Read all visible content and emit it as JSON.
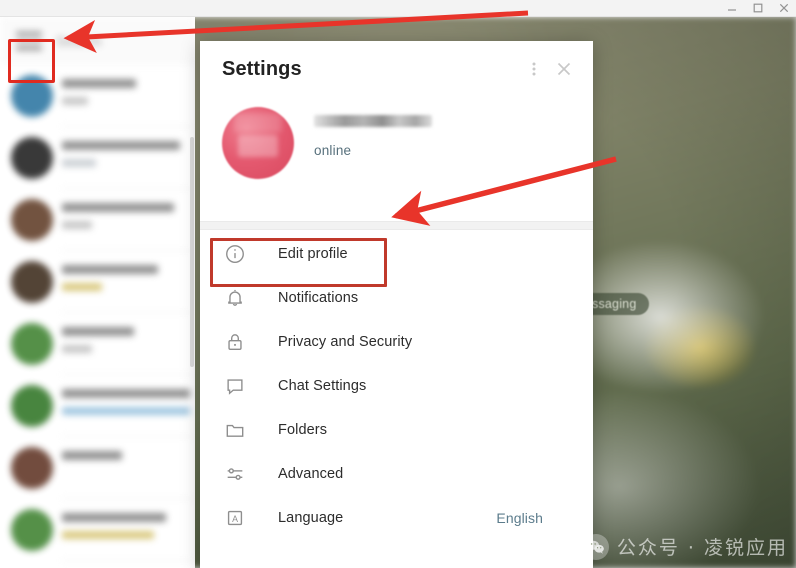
{
  "window": {
    "controls": [
      {
        "name": "minimize-button",
        "icon": "minimize-icon",
        "label": "Minimize"
      },
      {
        "name": "maximize-button",
        "icon": "maximize-icon",
        "label": "Maximize"
      },
      {
        "name": "close-button",
        "icon": "close-icon",
        "label": "Close"
      }
    ]
  },
  "sidebar": {
    "menu_icon": "hamburger-menu-icon",
    "search_placeholder": "Search",
    "chats": [
      {
        "avatar_color": "#3a7fa8",
        "name_w": 74,
        "msg_w": 26,
        "msg_color": "#c4c4c4",
        "msg2_w": 0,
        "msg2_color": "#ffffff"
      },
      {
        "avatar_color": "#2f2f2f",
        "name_w": 118,
        "msg_w": 34,
        "msg_color": "#c9ced3",
        "msg2_w": 0,
        "msg2_color": "#ffffff"
      },
      {
        "avatar_color": "#6b4a36",
        "name_w": 112,
        "msg_w": 30,
        "msg_color": "#c4c4c4",
        "msg2_w": 0,
        "msg2_color": "#ffffff"
      },
      {
        "avatar_color": "#4a3a2c",
        "name_w": 96,
        "msg_w": 40,
        "msg_color": "#d8c77a",
        "msg2_w": 0,
        "msg2_color": "#ffffff"
      },
      {
        "avatar_color": "#4c8b3f",
        "name_w": 72,
        "msg_w": 30,
        "msg_color": "#c4c4c4",
        "msg2_w": 0,
        "msg2_color": "#ffffff"
      },
      {
        "avatar_color": "#3f7f35",
        "name_w": 128,
        "msg_w": 128,
        "msg_color": "#9bc3de",
        "msg2_w": 0,
        "msg2_color": "#ffffff"
      },
      {
        "avatar_color": "#6b4334",
        "name_w": 60,
        "msg_w": 0,
        "msg_color": "#ffffff",
        "msg2_w": 0,
        "msg2_color": "#ffffff"
      },
      {
        "avatar_color": "#4c8b3f",
        "name_w": 104,
        "msg_w": 92,
        "msg_color": "#d8c77a",
        "msg2_w": 0,
        "msg2_color": "#ffffff"
      }
    ]
  },
  "background": {
    "badge_label": "ssaging"
  },
  "dialog": {
    "title": "Settings",
    "header_actions": [
      {
        "name": "more-options-button",
        "icon": "more-vertical-icon",
        "label": "More options"
      },
      {
        "name": "close-dialog-button",
        "icon": "close-icon",
        "label": "Close"
      }
    ],
    "profile": {
      "avatar_alt": "user-avatar",
      "name_redacted": "",
      "status": "online",
      "accent_color": "#e4596f"
    },
    "menu": [
      {
        "key": "edit-profile",
        "icon": "info-circle-icon",
        "label": "Edit profile",
        "value": ""
      },
      {
        "key": "notifications",
        "icon": "bell-icon",
        "label": "Notifications",
        "value": ""
      },
      {
        "key": "privacy-and-security",
        "icon": "lock-icon",
        "label": "Privacy and Security",
        "value": ""
      },
      {
        "key": "chat-settings",
        "icon": "chat-bubble-icon",
        "label": "Chat Settings",
        "value": ""
      },
      {
        "key": "folders",
        "icon": "folder-icon",
        "label": "Folders",
        "value": ""
      },
      {
        "key": "advanced",
        "icon": "sliders-icon",
        "label": "Advanced",
        "value": ""
      },
      {
        "key": "language",
        "icon": "letter-a-box-icon",
        "label": "Language",
        "value": "English"
      }
    ]
  },
  "annotations": {
    "highlight_color": "#e02b20",
    "highlight_color_alt": "#c0392b",
    "arrow_color": "#e8342a",
    "targets": [
      "hamburger-menu-icon",
      "edit-profile"
    ]
  },
  "watermark": {
    "text": "公众号 · 凌锐应用",
    "logo": "wechat-logo-icon"
  }
}
